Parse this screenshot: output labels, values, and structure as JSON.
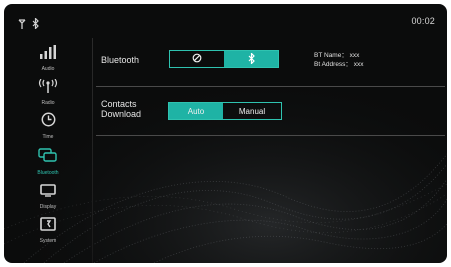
{
  "status_bar": {
    "clock": "00:02",
    "icons": [
      "signal-icon",
      "bluetooth-icon"
    ]
  },
  "sidebar": {
    "items": [
      {
        "label": "Audio",
        "icon": "equalizer-icon",
        "active": false
      },
      {
        "label": "Radio",
        "icon": "radio-antenna-icon",
        "active": false
      },
      {
        "label": "Time",
        "icon": "clock-icon",
        "active": false
      },
      {
        "label": "Bluetooth",
        "icon": "bluetooth-chat-icon",
        "active": true
      },
      {
        "label": "Display",
        "icon": "display-icon",
        "active": false
      },
      {
        "label": "System",
        "icon": "system-icon",
        "active": false
      }
    ]
  },
  "bluetooth_row": {
    "label": "Bluetooth",
    "options": [
      {
        "name": "off",
        "icon": "off-icon",
        "selected": false
      },
      {
        "name": "on",
        "icon": "bluetooth-icon",
        "selected": true
      }
    ],
    "bt_name_line": "BT Name： xxx",
    "bt_address_line": "Bt Address： xxx"
  },
  "contacts_row": {
    "label_line1": "Contacts",
    "label_line2": "Download",
    "options": [
      {
        "label": "Auto",
        "selected": true
      },
      {
        "label": "Manual",
        "selected": false
      }
    ]
  },
  "colors": {
    "accent": "#1fb3a5",
    "accent_border": "#2fc3b0",
    "background": "#0b0c0c",
    "text": "#e6e6e6"
  }
}
